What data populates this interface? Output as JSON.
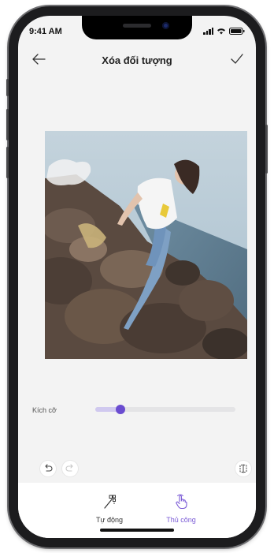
{
  "status_bar": {
    "time": "9:41 AM"
  },
  "header": {
    "title": "Xóa đối tượng"
  },
  "size_control": {
    "label": "Kích cỡ",
    "value_fraction": 0.18
  },
  "tabs": [
    {
      "label": "Tự động",
      "active": false
    },
    {
      "label": "Thủ công",
      "active": true
    }
  ],
  "icons": {
    "back": "arrow-left-icon",
    "confirm": "check-icon",
    "undo": "undo-icon",
    "redo": "redo-icon",
    "compare": "compare-icon",
    "auto_tab": "magic-wand-icon",
    "manual_tab": "hand-pointer-icon"
  },
  "colors": {
    "accent": "#6a4cd0",
    "tab_inactive": "#333333",
    "tab_active": "#7a5ad6"
  }
}
